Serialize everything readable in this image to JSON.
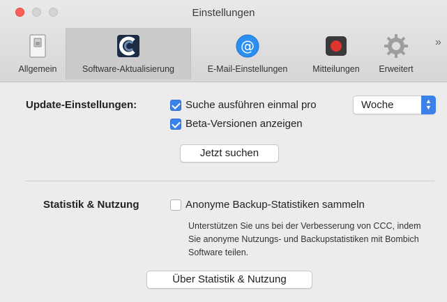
{
  "window": {
    "title": "Einstellungen"
  },
  "toolbar": {
    "items": [
      {
        "label": "Allgemein",
        "icon": "switch-icon"
      },
      {
        "label": "Software-Aktualisierung",
        "icon": "ccc-logo-icon"
      },
      {
        "label": "E-Mail-Einstellungen",
        "icon": "at-sign-icon"
      },
      {
        "label": "Mitteilungen",
        "icon": "record-icon"
      },
      {
        "label": "Erweitert",
        "icon": "gear-icon"
      }
    ],
    "overflow": "»"
  },
  "update": {
    "section_label": "Update-Einstellungen:",
    "check_label": "Suche ausführen einmal pro",
    "check_checked": true,
    "interval_value": "Woche",
    "beta_label": "Beta-Versionen anzeigen",
    "beta_checked": true,
    "search_now_button": "Jetzt suchen"
  },
  "stats": {
    "section_label": "Statistik & Nutzung",
    "collect_label": "Anonyme Backup-Statistiken sammeln",
    "collect_checked": false,
    "description": "Unterstützen Sie uns bei der Verbesserung von CCC, indem Sie anonyme Nutzungs- und Backupstatistiken mit Bombich Software teilen.",
    "about_button": "Über Statistik & Nutzung"
  },
  "colors": {
    "accent": "#3b82e8",
    "close": "#fc5f57",
    "record": "#e0342f"
  }
}
